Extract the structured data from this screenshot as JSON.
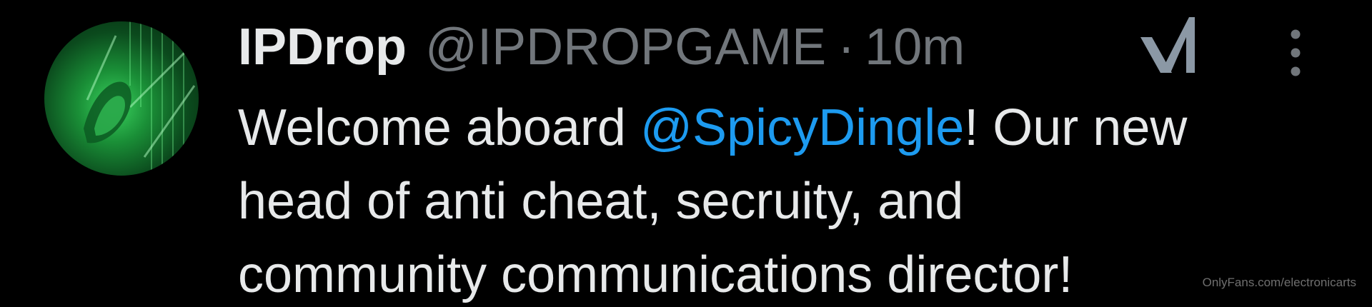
{
  "tweet": {
    "author": {
      "display_name": "IPDrop",
      "handle": "@IPDROPGAME",
      "separator": "·",
      "time": "10m",
      "avatar_icon": "matrix-green-avatar"
    },
    "body": {
      "line1_prefix": "Welcome aboard ",
      "mention": "@SpicyDingle",
      "line1_suffix": "! Our new",
      "line2": "head of anti cheat, secruity, and",
      "line3": "community communications director!"
    },
    "icons": {
      "grok": "grok-icon",
      "more": "more-options-icon"
    }
  },
  "watermark": "OnlyFans.com/electronicarts",
  "colors": {
    "background": "#000000",
    "text": "#e7e9ea",
    "secondary": "#71767b",
    "mention": "#1d9bf0",
    "avatar_green": "#2fbf4f"
  }
}
